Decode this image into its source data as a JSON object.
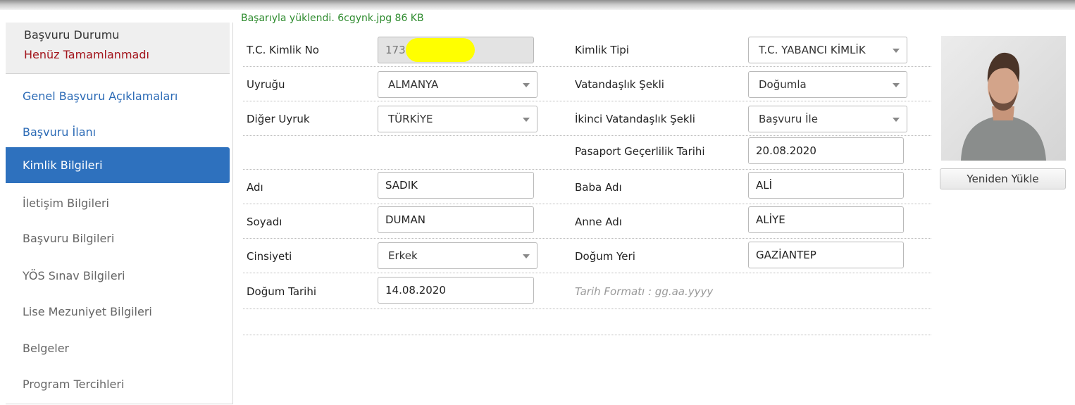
{
  "upload_message": "Başarıyla yüklendi. 6cgynk.jpg 86 KB",
  "sidebar": {
    "status_title": "Başvuru Durumu",
    "status_value": "Henüz Tamamlanmadı",
    "items": [
      {
        "label": "Genel Başvuru Açıklamaları"
      },
      {
        "label": "Başvuru İlanı"
      },
      {
        "label": "Kimlik Bilgileri"
      },
      {
        "label": "İletişim Bilgileri"
      },
      {
        "label": "Başvuru Bilgileri"
      },
      {
        "label": "YÖS Sınav Bilgileri"
      },
      {
        "label": "Lise Mezuniyet Bilgileri"
      },
      {
        "label": "Belgeler"
      },
      {
        "label": "Program Tercihleri"
      }
    ]
  },
  "form": {
    "tc_kimlik_no": {
      "label": "T.C. Kimlik No",
      "value": "173"
    },
    "kimlik_tipi": {
      "label": "Kimlik Tipi",
      "value": "T.C. YABANCI KİMLİK"
    },
    "uyrugu": {
      "label": "Uyruğu",
      "value": "ALMANYA"
    },
    "vatandaslik_sekli": {
      "label": "Vatandaşlık Şekli",
      "value": "Doğumla"
    },
    "diger_uyruk": {
      "label": "Diğer Uyruk",
      "value": "TÜRKİYE"
    },
    "ikinci_vatandaslik_sekli": {
      "label": "İkinci Vatandaşlık Şekli",
      "value": "Başvuru İle"
    },
    "pasaport_gecerlilik": {
      "label": "Pasaport Geçerlilik Tarihi",
      "value": "20.08.2020"
    },
    "adi": {
      "label": "Adı",
      "value": "SADIK"
    },
    "baba_adi": {
      "label": "Baba Adı",
      "value": "ALİ"
    },
    "soyadi": {
      "label": "Soyadı",
      "value": "DUMAN"
    },
    "anne_adi": {
      "label": "Anne Adı",
      "value": "ALİYE"
    },
    "cinsiyeti": {
      "label": "Cinsiyeti",
      "value": "Erkek"
    },
    "dogum_yeri": {
      "label": "Doğum Yeri",
      "value": "GAZİANTEP"
    },
    "dogum_tarihi": {
      "label": "Doğum Tarihi",
      "value": "14.08.2020"
    },
    "date_hint": "Tarih Formatı : gg.aa.yyyy"
  },
  "photo": {
    "reupload_label": "Yeniden Yükle"
  },
  "colors": {
    "active_nav": "#2e71be",
    "link": "#2c6bb6",
    "status_warning": "#a3151c",
    "success": "#2e8b2e",
    "redaction": "#ffff00"
  }
}
